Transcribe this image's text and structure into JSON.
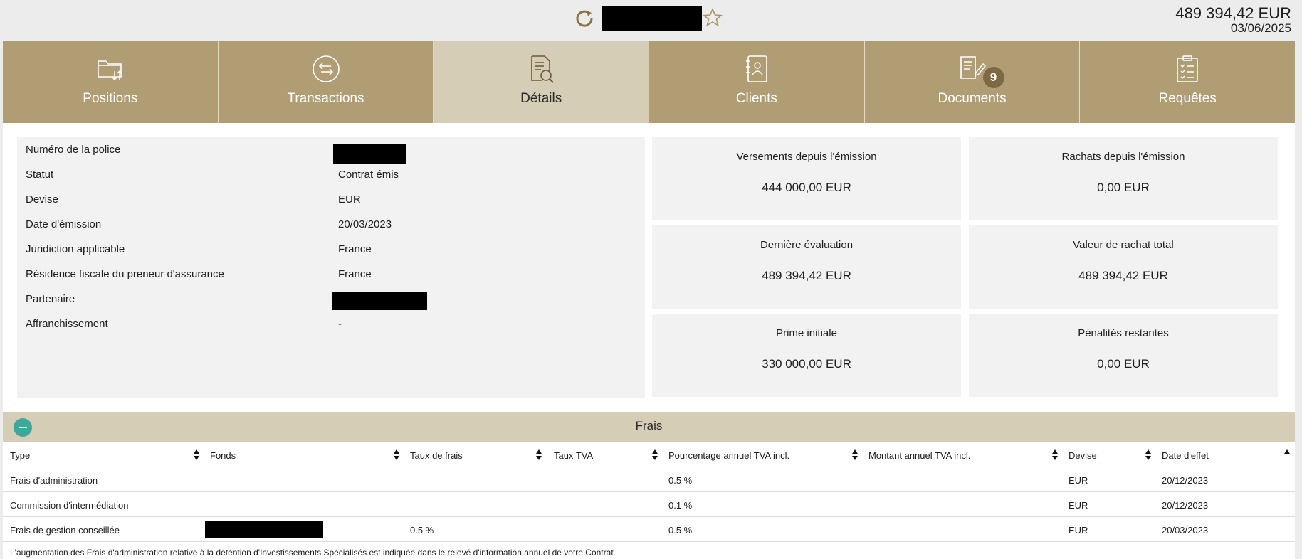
{
  "header": {
    "total_amount": "489 394,42 EUR",
    "date": "03/06/2025",
    "icons": [
      "refresh-icon",
      "star-icon"
    ]
  },
  "tabs": [
    {
      "label": "Positions",
      "icon": "folder-transfer-icon"
    },
    {
      "label": "Transactions",
      "icon": "exchange-circle-icon"
    },
    {
      "label": "Détails",
      "icon": "document-search-icon",
      "active": true
    },
    {
      "label": "Clients",
      "icon": "contact-book-icon"
    },
    {
      "label": "Documents",
      "icon": "document-edit-icon",
      "badge": "9"
    },
    {
      "label": "Requêtes",
      "icon": "clipboard-checklist-icon"
    }
  ],
  "details": {
    "rows": [
      {
        "label": "Numéro de la police",
        "value": ""
      },
      {
        "label": "Statut",
        "value": "Contrat émis"
      },
      {
        "label": "Devise",
        "value": "EUR"
      },
      {
        "label": "Date d'émission",
        "value": "20/03/2023"
      },
      {
        "label": "Juridiction applicable",
        "value": "France"
      },
      {
        "label": "Résidence fiscale du preneur d'assurance",
        "value": "France"
      },
      {
        "label": "Partenaire",
        "value": ""
      },
      {
        "label": "Affranchissement",
        "value": "-"
      }
    ]
  },
  "cards": [
    {
      "title": "Versements depuis l'émission",
      "value": "444 000,00 EUR"
    },
    {
      "title": "Rachats depuis l'émission",
      "value": "0,00 EUR"
    },
    {
      "title": "Dernière évaluation",
      "value": "489 394,42 EUR"
    },
    {
      "title": "Valeur de rachat total",
      "value": "489 394,42 EUR"
    },
    {
      "title": "Prime initiale",
      "value": "330 000,00 EUR"
    },
    {
      "title": "Pénalités restantes",
      "value": "0,00 EUR"
    }
  ],
  "frais": {
    "title": "Frais",
    "columns": [
      "Type",
      "Fonds",
      "Taux de frais",
      "Taux TVA",
      "Pourcentage annuel TVA incl.",
      "Montant annuel TVA incl.",
      "Devise",
      "Date d'effet"
    ],
    "rows": [
      [
        "Frais d'administration",
        "",
        "-",
        "-",
        "0.5 %",
        "-",
        "EUR",
        "20/12/2023"
      ],
      [
        "Commission d'intermédiation",
        "",
        "-",
        "-",
        "0.1 %",
        "-",
        "EUR",
        "20/12/2023"
      ],
      [
        "Frais de gestion conseillée",
        "",
        "0.5 %",
        "-",
        "0.5 %",
        "-",
        "EUR",
        "20/03/2023"
      ]
    ],
    "footnote": "L'augmentation des Frais d'administration relative à la détention d'Investissements Spécialisés est indiquée dans le relevé d'information annuel de votre Contrat"
  }
}
